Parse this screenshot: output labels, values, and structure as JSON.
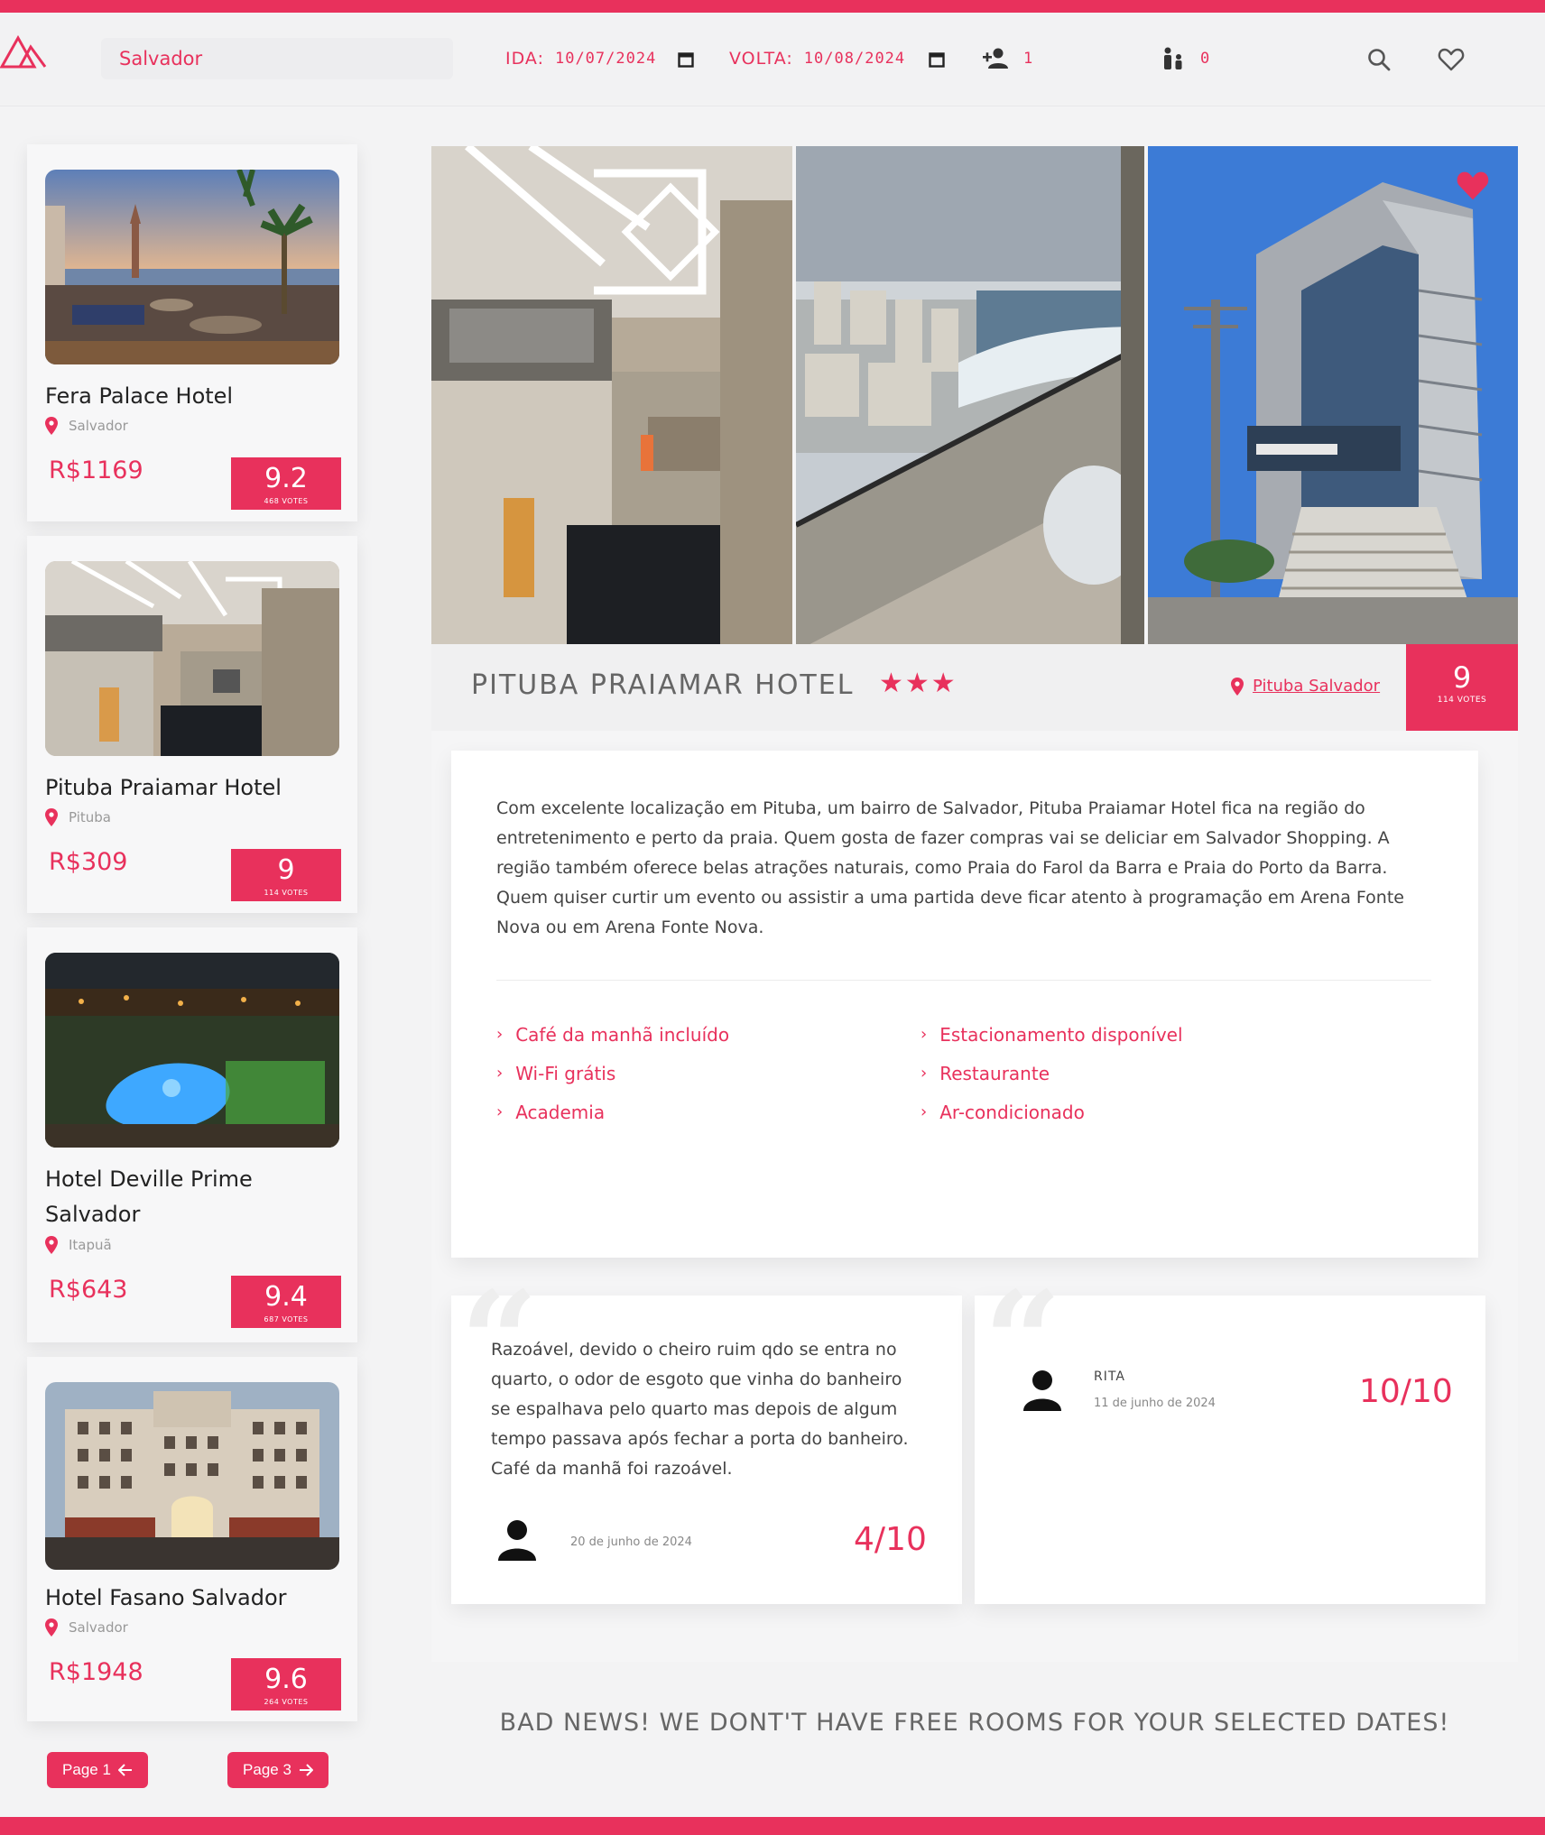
{
  "header": {
    "search_value": "Salvador",
    "ida_label": "IDA:",
    "ida_value": "10/07/2024",
    "volta_label": "VOLTA:",
    "volta_value": "10/08/2024",
    "adults_count": "1",
    "children_count": "0"
  },
  "colors": {
    "accent": "#e8315c"
  },
  "sidebar": {
    "hotels": [
      {
        "name": "Fera Palace Hotel",
        "location": "Salvador",
        "price": "R$1169",
        "score": "9.2",
        "score_sub": "468 VOTES"
      },
      {
        "name": "Pituba Praiamar Hotel",
        "location": "Pituba",
        "price": "R$309",
        "score": "9",
        "score_sub": "114 VOTES"
      },
      {
        "name": "Hotel Deville Prime Salvador",
        "location": "Itapuã",
        "price": "R$643",
        "score": "9.4",
        "score_sub": "687 VOTES"
      },
      {
        "name": "Hotel Fasano Salvador",
        "location": "Salvador",
        "price": "R$1948",
        "score": "9.6",
        "score_sub": "264 VOTES"
      }
    ],
    "prev_page": "Page 1",
    "next_page": "Page 3"
  },
  "main": {
    "hotel_title": "PITUBA PRAIAMAR HOTEL",
    "stars": "★★★",
    "location_link": "Pituba Salvador",
    "score": "9",
    "score_sub": "114 VOTES",
    "description": "Com excelente localização em Pituba, um bairro de Salvador, Pituba Praiamar Hotel fica na região do entretenimento e perto da praia. Quem gosta de fazer compras vai se deliciar em Salvador Shopping. A região também oferece belas atrações naturais, como Praia do Farol da Barra e Praia do Porto da Barra. Quem quiser curtir um evento ou assistir a uma partida deve ficar atento à programação em Arena Fonte Nova ou em Arena Fonte Nova.",
    "amenities": [
      "Café da manhã incluído",
      "Estacionamento disponível",
      "Wi-Fi grátis",
      "Restaurante",
      "Academia",
      "Ar-condicionado"
    ],
    "reviews": [
      {
        "text": "Razoável, devido o cheiro ruim qdo se entra no quarto, o odor de esgoto que vinha do banheiro se espalhava pelo quarto mas depois de algum tempo passava após fechar a porta do banheiro. Café da manhã foi razoável.",
        "author": "",
        "date": "20 de junho de 2024",
        "score": "4/10"
      },
      {
        "text": "",
        "author": "RITA",
        "date": "11 de junho de 2024",
        "score": "10/10"
      }
    ],
    "bad_news": "BAD NEWS! WE DONT'T HAVE FREE ROOMS FOR YOUR SELECTED DATES!"
  }
}
